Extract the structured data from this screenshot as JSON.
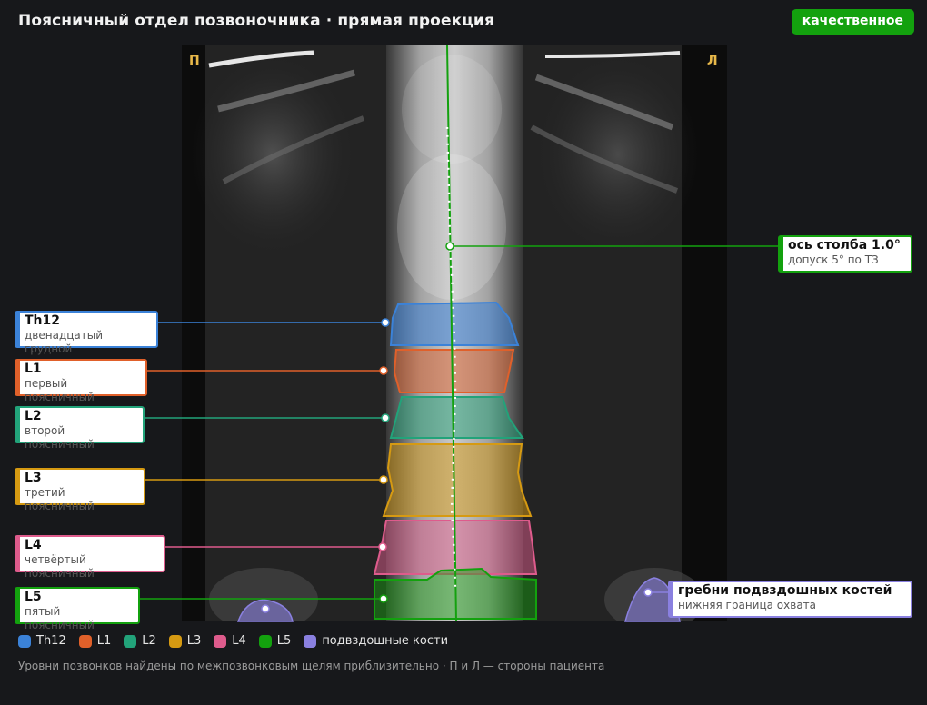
{
  "header": {
    "title": "Поясничный отдел позвоночника · прямая проекция",
    "badge": "качественное"
  },
  "image": {
    "side_right_marker": "П",
    "side_left_marker": "Л"
  },
  "annotations": {
    "axis": {
      "title": "ось столба 1.0°",
      "subtitle": "допуск 5° по ТЗ",
      "color": "#13a10e"
    },
    "th12": {
      "title": "Th12",
      "subtitle": "двенадцатый грудной",
      "color": "#3b82d8"
    },
    "l1": {
      "title": "L1",
      "subtitle": "первый поясничный",
      "color": "#e0602a"
    },
    "l2": {
      "title": "L2",
      "subtitle": "второй поясничный",
      "color": "#22a37a"
    },
    "l3": {
      "title": "L3",
      "subtitle": "третий поясничный",
      "color": "#d69a12"
    },
    "l4": {
      "title": "L4",
      "subtitle": "четвёртый поясничный",
      "color": "#de5b8c"
    },
    "l5": {
      "title": "L5",
      "subtitle": "пятый поясничный",
      "color": "#13a10e"
    },
    "iliac": {
      "title": "гребни подвздошных костей",
      "subtitle": "нижняя граница охвата",
      "color": "#8a80e0"
    }
  },
  "legend": [
    {
      "label": "Th12",
      "color": "#3b82d8"
    },
    {
      "label": "L1",
      "color": "#e0602a"
    },
    {
      "label": "L2",
      "color": "#22a37a"
    },
    {
      "label": "L3",
      "color": "#d69a12"
    },
    {
      "label": "L4",
      "color": "#de5b8c"
    },
    {
      "label": "L5",
      "color": "#13a10e"
    },
    {
      "label": "подвздошные кости",
      "color": "#8a80e0"
    }
  ],
  "footnote": "Уровни позвонков найдены по межпозвонковым щелям приблизительно · П и Л — стороны пациента"
}
